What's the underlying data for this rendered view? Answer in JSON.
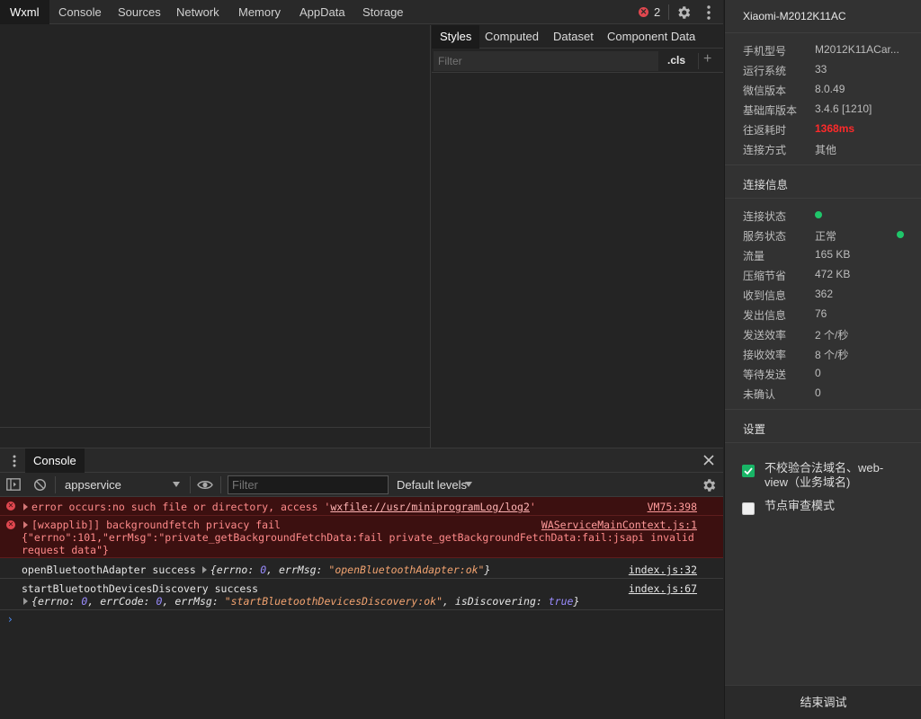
{
  "tabs": [
    {
      "label": "Wxml"
    },
    {
      "label": "Console"
    },
    {
      "label": "Sources"
    },
    {
      "label": "Network"
    },
    {
      "label": "Memory"
    },
    {
      "label": "AppData"
    },
    {
      "label": "Storage"
    }
  ],
  "error_badge": {
    "icon_text": "✕",
    "count": "2"
  },
  "styles": {
    "tabs": [
      {
        "label": "Styles"
      },
      {
        "label": "Computed"
      },
      {
        "label": "Dataset"
      },
      {
        "label": "Component Data"
      }
    ],
    "filter_placeholder": "Filter",
    "cls_label": ".cls",
    "plus_label": "+"
  },
  "drawer": {
    "tab_label": "Console"
  },
  "console_toolbar": {
    "context": "appservice",
    "filter_placeholder": "Filter",
    "levels": "Default levels"
  },
  "console_messages": {
    "m1": {
      "text_prefix": "error occurs:no such file or directory, access '",
      "link": "wxfile://usr/miniprogramLog/log2",
      "text_suffix": "'",
      "source": "VM75:398"
    },
    "m2": {
      "line1": "[wxapplib]] backgroundfetch privacy fail",
      "line2": "{\"errno\":101,\"errMsg\":\"private_getBackgroundFetchData:fail private_getBackgroundFetchData:fail:jsapi invalid",
      "line3": "request data\"}",
      "source": "WAServiceMainContext.js:1"
    },
    "m3": {
      "text": "openBluetoothAdapter success ",
      "obj_open": "{",
      "k1": "errno: ",
      "v1": "0",
      "sep1": ", ",
      "k2": "errMsg: ",
      "v2": "\"openBluetoothAdapter:ok\"",
      "obj_close": "}",
      "source": "index.js:32"
    },
    "m4": {
      "text": "startBluetoothDevicesDiscovery success",
      "obj_open": "{",
      "k1": "errno: ",
      "v1": "0",
      "sep1": ", ",
      "k2": "errCode: ",
      "v2": "0",
      "sep2": ", ",
      "k3": "errMsg: ",
      "v3": "\"startBluetoothDevicesDiscovery:ok\"",
      "sep3": ", ",
      "k4": "isDiscovering: ",
      "v4": "true",
      "obj_close": "}",
      "source": "index.js:67"
    },
    "prompt": "›"
  },
  "device": {
    "name": "Xiaomi-M2012K11AC",
    "info": [
      {
        "label": "手机型号",
        "value": "M2012K11ACar..."
      },
      {
        "label": "运行系统",
        "value": "33"
      },
      {
        "label": "微信版本",
        "value": "8.0.49"
      },
      {
        "label": "基础库版本",
        "value": "3.4.6 [1210]"
      },
      {
        "label": "往返耗时",
        "value": "1368ms"
      },
      {
        "label": "连接方式",
        "value": "其他"
      }
    ],
    "connection_title": "连接信息",
    "connection": [
      {
        "label": "连接状态",
        "value": ""
      },
      {
        "label": "服务状态",
        "value": "正常"
      },
      {
        "label": "流量",
        "value": "165 KB"
      },
      {
        "label": "压缩节省",
        "value": "472 KB"
      },
      {
        "label": "收到信息",
        "value": "362"
      },
      {
        "label": "发出信息",
        "value": "76"
      },
      {
        "label": "发送效率",
        "value": "2 个/秒"
      },
      {
        "label": "接收效率",
        "value": "8 个/秒"
      },
      {
        "label": "等待发送",
        "value": "0"
      },
      {
        "label": "未确认",
        "value": "0"
      }
    ],
    "settings_title": "设置",
    "settings": [
      {
        "label": "不校验合法域名、web-view（业务域名)",
        "checked": true
      },
      {
        "label": "节点审查模式",
        "checked": false
      }
    ],
    "end_debug": "结束调试"
  },
  "colors": {
    "status_green": "#1fc66a",
    "error_red": "#e0474f",
    "latency_red": "#ff2a2a",
    "checkbox_green": "#18b566"
  }
}
